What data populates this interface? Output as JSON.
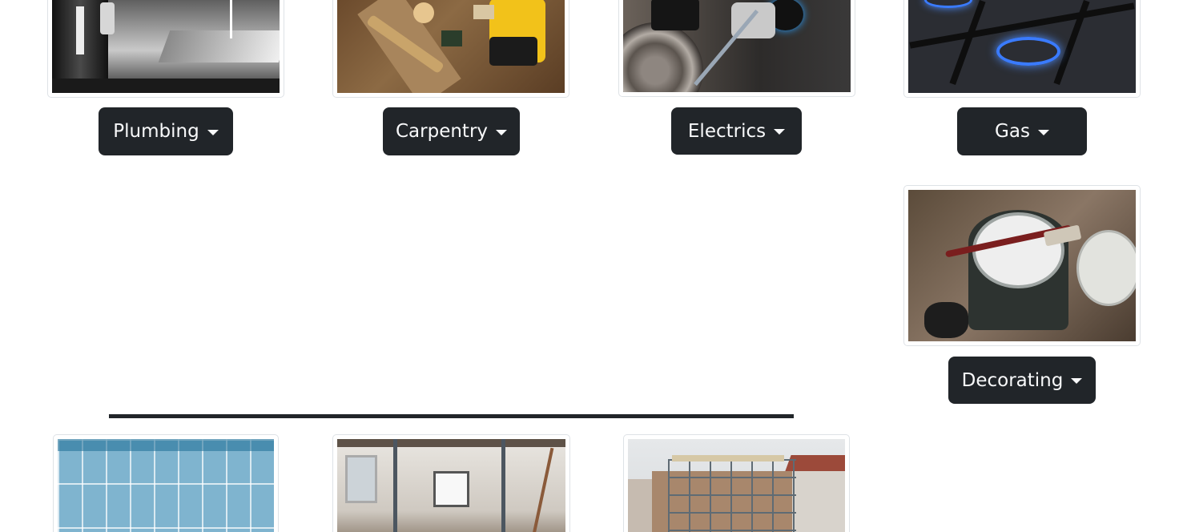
{
  "services": {
    "plumbing": {
      "label": "Plumbing"
    },
    "carpentry": {
      "label": "Carpentry"
    },
    "electrics": {
      "label": "Electrics"
    },
    "gas": {
      "label": "Gas"
    },
    "decorating": {
      "label": "Decorating"
    }
  },
  "colors": {
    "button_bg": "#212529",
    "button_text": "#f8f9fa",
    "divider": "#212529",
    "thumb_border": "#dee2e6"
  }
}
